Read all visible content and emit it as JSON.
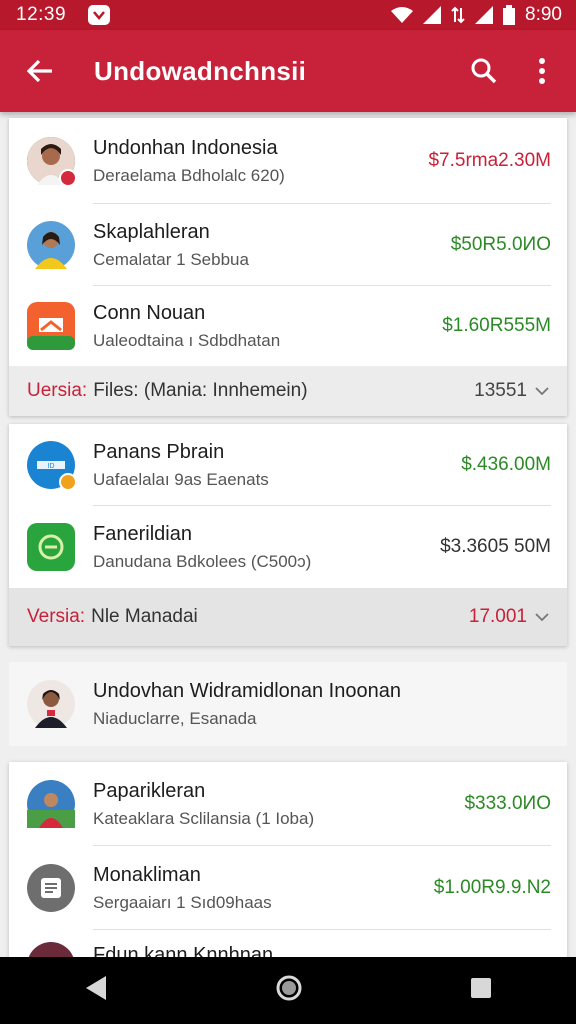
{
  "status_bar": {
    "time": "12:39",
    "battery": "8:90"
  },
  "app_bar": {
    "title": "Undowadnchnsii"
  },
  "items": [
    {
      "name": "Undonhan Indonesia",
      "sub": "Deraelama Bdholalc 620)",
      "amount": "$7.5rma2.30M",
      "amount_color": "red"
    },
    {
      "name": "Skaplahleran",
      "sub": "Cemalatar 1 Sebbua",
      "amount": "$50R5.0ИO",
      "amount_color": "green"
    },
    {
      "name": "Conn Nouan",
      "sub": "Ualeodtaina ı Sdbdhatan",
      "amount": "$1.60R555M",
      "amount_color": "green"
    },
    {
      "name": "Panans Pbrain",
      "sub": "Uafaelalaı 9as Eaenats",
      "amount": "$.436.00M",
      "amount_color": "green"
    },
    {
      "name": "Fanerildian",
      "sub": "Danudana Bdkolees (C500ɔ)",
      "amount": "$3.3605 50M",
      "amount_color": "dark"
    },
    {
      "name": "Undovhan Widramidlonan Inoonan",
      "sub": "Niaduclarre, Esanada",
      "amount": "",
      "amount_color": "dark"
    },
    {
      "name": "Paparikleran",
      "sub": "Kateaklara Sclilansia (1 Ioba)",
      "amount": "$333.0ИO",
      "amount_color": "green"
    },
    {
      "name": "Monakliman",
      "sub": "Sergaaiarı 1 Sıd09haas",
      "amount": "$1.00R9.9.N2",
      "amount_color": "green"
    },
    {
      "name": "Fdun kann Knnhnan",
      "sub": "",
      "amount": "",
      "amount_color": "dark"
    }
  ],
  "sections": [
    {
      "label_prefix": "Uersia:",
      "label_rest": "Files: (Mania: Innhemein)",
      "count": "13551"
    },
    {
      "label_prefix": "Versia:",
      "label_rest": "Nle Manadai",
      "count": "17.001"
    }
  ],
  "colors": {
    "primary": "#c8213a",
    "status": "#b8182c",
    "positive": "#2c8a26"
  }
}
